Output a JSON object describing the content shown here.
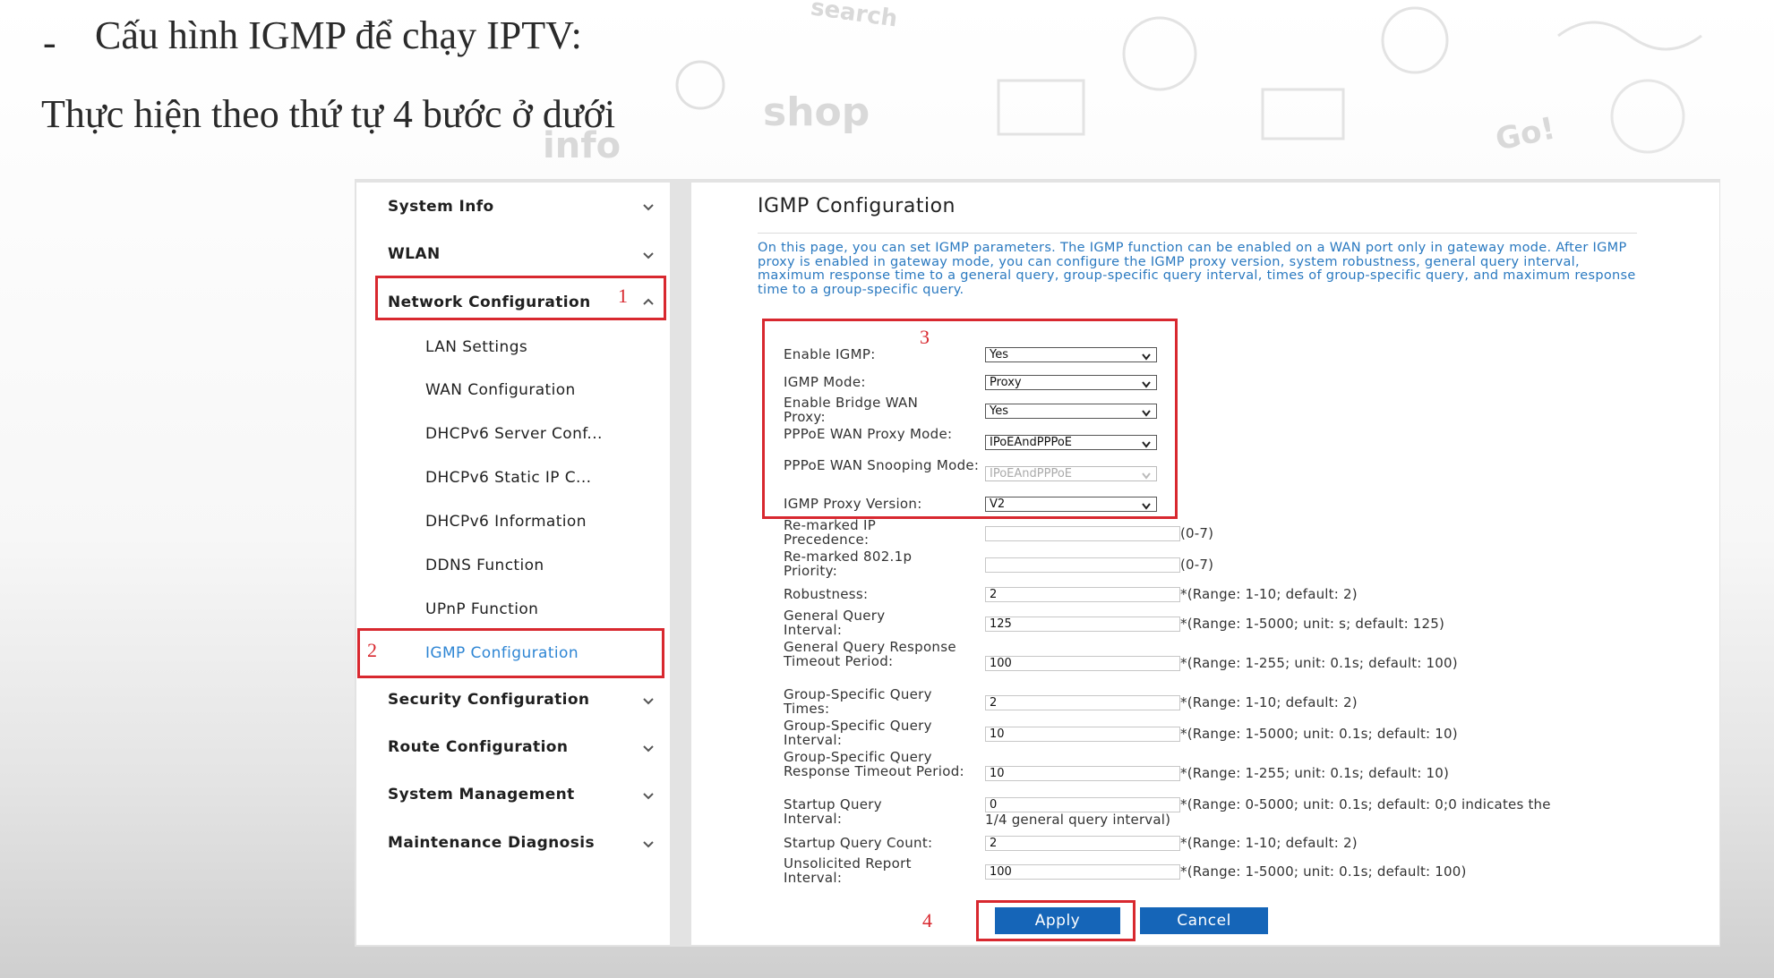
{
  "slide": {
    "bullet": "-",
    "heading": "Cấu hình IGMP để chạy IPTV:",
    "subheading": "Thực hiện theo thứ tự 4 bước ở dưới"
  },
  "background_words": [
    "shop",
    "info",
    "Go!",
    "search"
  ],
  "sidebar": {
    "items": [
      {
        "label": "System Info",
        "type": "main"
      },
      {
        "label": "WLAN",
        "type": "main"
      },
      {
        "label": "Network Configuration",
        "type": "main"
      },
      {
        "label": "LAN Settings",
        "type": "sub"
      },
      {
        "label": "WAN Configuration",
        "type": "sub"
      },
      {
        "label": "DHCPv6 Server Conf...",
        "type": "sub"
      },
      {
        "label": "DHCPv6 Static IP C...",
        "type": "sub"
      },
      {
        "label": "DHCPv6 Information",
        "type": "sub"
      },
      {
        "label": "DDNS Function",
        "type": "sub"
      },
      {
        "label": "UPnP Function",
        "type": "sub"
      },
      {
        "label": "IGMP Configuration",
        "type": "sub",
        "active": true
      },
      {
        "label": "Security Configuration",
        "type": "main"
      },
      {
        "label": "Route Configuration",
        "type": "main"
      },
      {
        "label": "System Management",
        "type": "main"
      },
      {
        "label": "Maintenance Diagnosis",
        "type": "main"
      }
    ]
  },
  "annotations": {
    "step1": "1",
    "step2": "2",
    "step3": "3",
    "step4": "4",
    "color": "#d8282f"
  },
  "main": {
    "title": "IGMP Configuration",
    "description": "On this page, you can set IGMP parameters. The IGMP function can be enabled on a WAN port only in gateway mode. After IGMP proxy is enabled in gateway mode, you can configure the IGMP proxy version, system robustness, general query interval, maximum response time to a general query, group-specific query interval, times of group-specific query, and maximum response time to a group-specific query.",
    "selects": {
      "enable_igmp": {
        "label": "Enable IGMP:",
        "value": "Yes"
      },
      "igmp_mode": {
        "label": "IGMP Mode:",
        "value": "Proxy"
      },
      "bridge_wan_proxy": {
        "label": "Enable Bridge WAN Proxy:",
        "value": "Yes"
      },
      "pppoe_proxy_mode": {
        "label": "PPPoE WAN Proxy Mode:",
        "value": "IPoEAndPPPoE"
      },
      "pppoe_snooping_mode": {
        "label": "PPPoE WAN Snooping Mode:",
        "value": "IPoEAndPPPoE",
        "disabled": true
      },
      "proxy_version": {
        "label": "IGMP Proxy Version:",
        "value": "V2"
      }
    },
    "fields": {
      "ip_precedence": {
        "label": "Re-marked IP Precedence:",
        "value": "",
        "hint": "(0-7)"
      },
      "priority_8021p": {
        "label": "Re-marked 802.1p Priority:",
        "value": "",
        "hint": "(0-7)"
      },
      "robustness": {
        "label": "Robustness:",
        "value": "2",
        "hint": "*(Range: 1-10; default: 2)"
      },
      "general_query_interval": {
        "label": "General Query Interval:",
        "value": "125",
        "hint": "*(Range: 1-5000; unit: s; default: 125)"
      },
      "general_query_timeout": {
        "label": "General Query Response Timeout Period:",
        "value": "100",
        "hint": "*(Range: 1-255; unit: 0.1s; default: 100)"
      },
      "gs_query_times": {
        "label": "Group-Specific Query Times:",
        "value": "2",
        "hint": "*(Range: 1-10; default: 2)"
      },
      "gs_query_interval": {
        "label": "Group-Specific Query Interval:",
        "value": "10",
        "hint": "*(Range: 1-5000; unit: 0.1s; default: 10)"
      },
      "gs_query_timeout": {
        "label": "Group-Specific Query Response Timeout Period:",
        "value": "10",
        "hint": "*(Range: 1-255; unit: 0.1s; default: 10)"
      },
      "startup_query_interval": {
        "label": "Startup Query Interval:",
        "value": "0",
        "hint": "*(Range: 0-5000; unit: 0.1s; default: 0;0 indicates the",
        "hint_cont": "1/4 general query interval)"
      },
      "startup_query_count": {
        "label": "Startup Query Count:",
        "value": "2",
        "hint": "*(Range: 1-10; default: 2)"
      },
      "unsolicited_report_interval": {
        "label": "Unsolicited Report Interval:",
        "value": "100",
        "hint": "*(Range: 1-5000; unit: 0.1s; default: 100)"
      }
    },
    "buttons": {
      "apply": "Apply",
      "cancel": "Cancel"
    }
  },
  "colors": {
    "accent": "#2f86d4",
    "button": "#1565b8",
    "description": "#2a79c0"
  }
}
